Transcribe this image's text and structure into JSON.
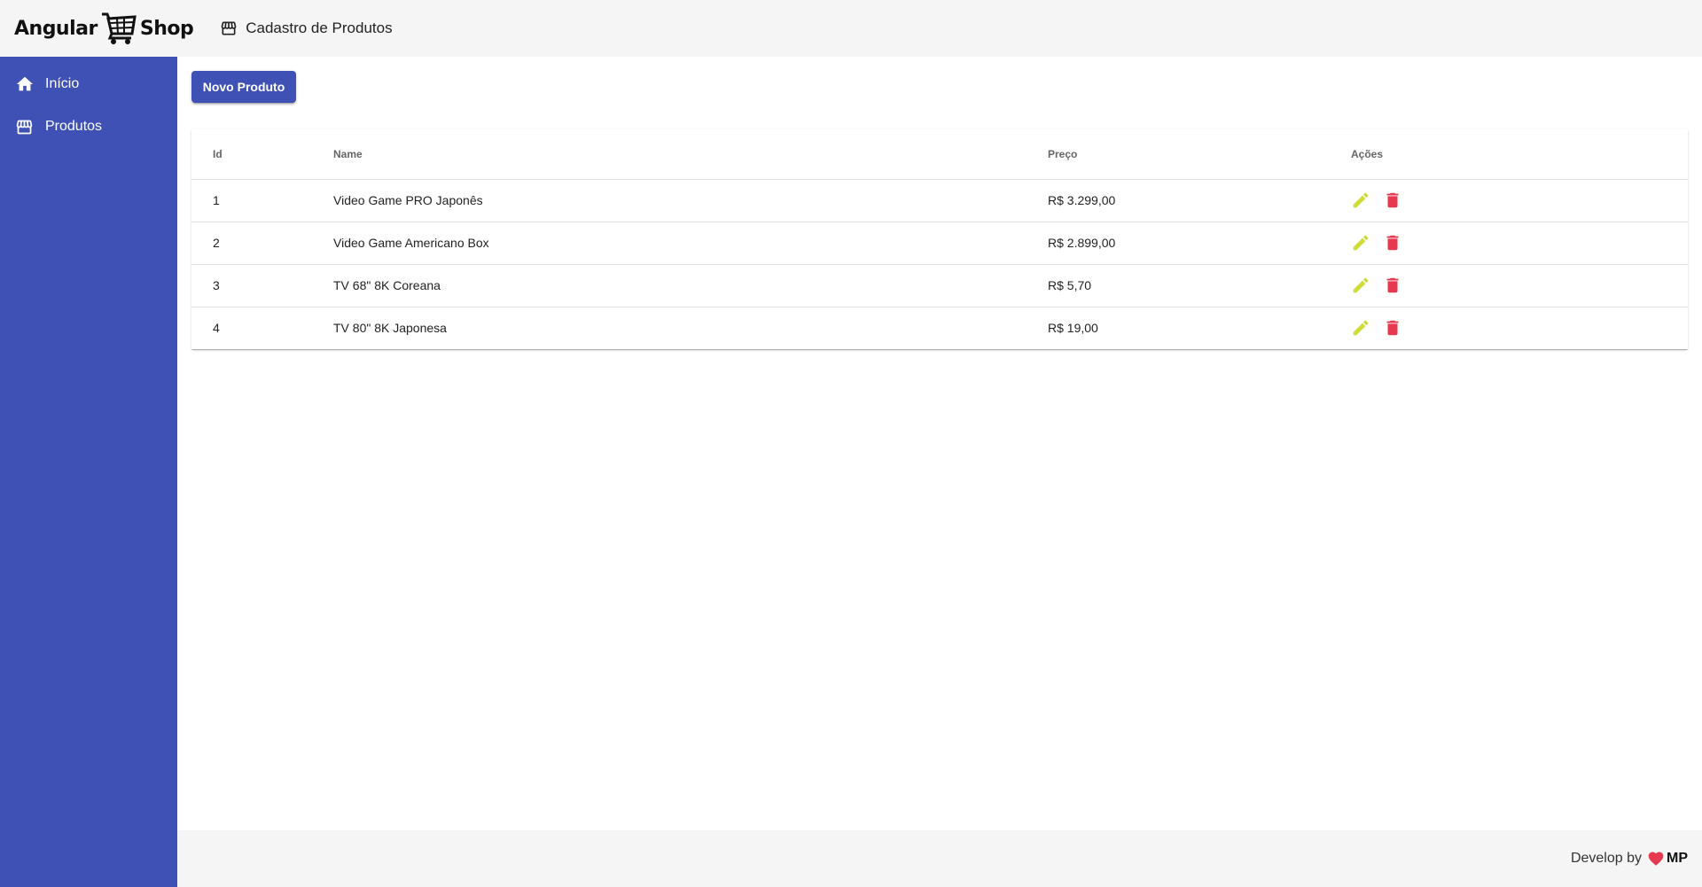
{
  "header": {
    "logo_left": "Angular",
    "logo_right": "Shop",
    "page_title": "Cadastro de Produtos",
    "page_icon": "storefront-icon"
  },
  "sidebar": {
    "items": [
      {
        "label": "Início",
        "icon": "home-icon"
      },
      {
        "label": "Produtos",
        "icon": "storefront-icon"
      }
    ]
  },
  "main": {
    "new_button_label": "Novo Produto",
    "table": {
      "columns": [
        "Id",
        "Name",
        "Preço",
        "Ações"
      ],
      "rows": [
        {
          "id": "1",
          "name": "Video Game PRO Japonês",
          "price": "R$ 3.299,00"
        },
        {
          "id": "2",
          "name": "Video Game Americano Box",
          "price": "R$ 2.899,00"
        },
        {
          "id": "3",
          "name": "TV 68\" 8K Coreana",
          "price": "R$ 5,70"
        },
        {
          "id": "4",
          "name": "TV 80\" 8K Japonesa",
          "price": "R$ 19,00"
        }
      ]
    }
  },
  "footer": {
    "text": "Develop by",
    "signature": "MP"
  },
  "colors": {
    "primary": "#3f51b5",
    "edit": "#cddc39",
    "delete": "#e53950",
    "heart": "#e53950"
  }
}
